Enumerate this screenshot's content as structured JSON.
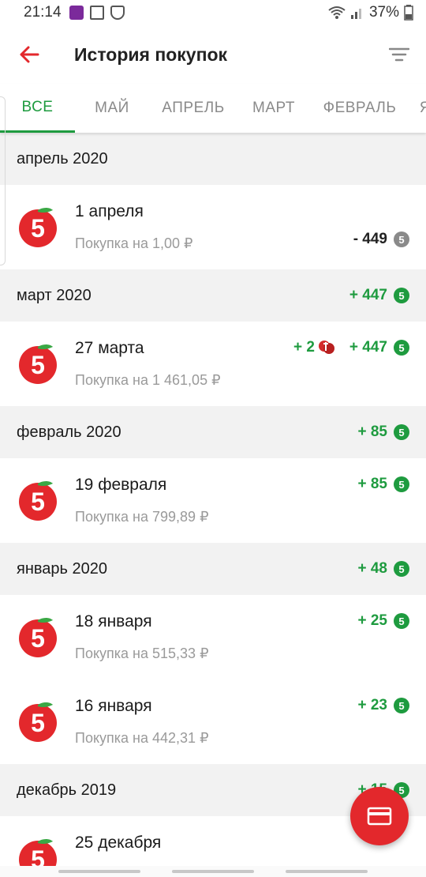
{
  "status": {
    "time": "21:14",
    "battery": "37%"
  },
  "header": {
    "title": "История покупок"
  },
  "tabs": [
    "ВСЕ",
    "МАЙ",
    "АПРЕЛЬ",
    "МАРТ",
    "ФЕВРАЛЬ",
    "Я"
  ],
  "colors": {
    "accent": "#1e9b3f",
    "brand": "#e3282c"
  },
  "sections": [
    {
      "title": "апрель 2020",
      "total": ""
    },
    {
      "title": "март 2020",
      "total": "+ 447"
    },
    {
      "title": "февраль 2020",
      "total": "+ 85"
    },
    {
      "title": "январь 2020",
      "total": "+ 48"
    },
    {
      "title": "декабрь 2019",
      "total": "+ 15"
    }
  ],
  "items": [
    {
      "date": "1 апреля",
      "sum": "Покупка на 1,00 ₽",
      "bonus": "- 449"
    },
    {
      "date": "27 марта",
      "sum": "Покупка на 1 461,05 ₽",
      "extra": "+ 2",
      "bonus": "+ 447"
    },
    {
      "date": "19 февраля",
      "sum": "Покупка на 799,89 ₽",
      "bonus": "+ 85"
    },
    {
      "date": "18 января",
      "sum": "Покупка на 515,33 ₽",
      "bonus": "+ 25"
    },
    {
      "date": "16 января",
      "sum": "Покупка на 442,31 ₽",
      "bonus": "+ 23"
    },
    {
      "date": "25 декабря",
      "sum": "",
      "bonus": ""
    }
  ],
  "coin_glyph": "5"
}
